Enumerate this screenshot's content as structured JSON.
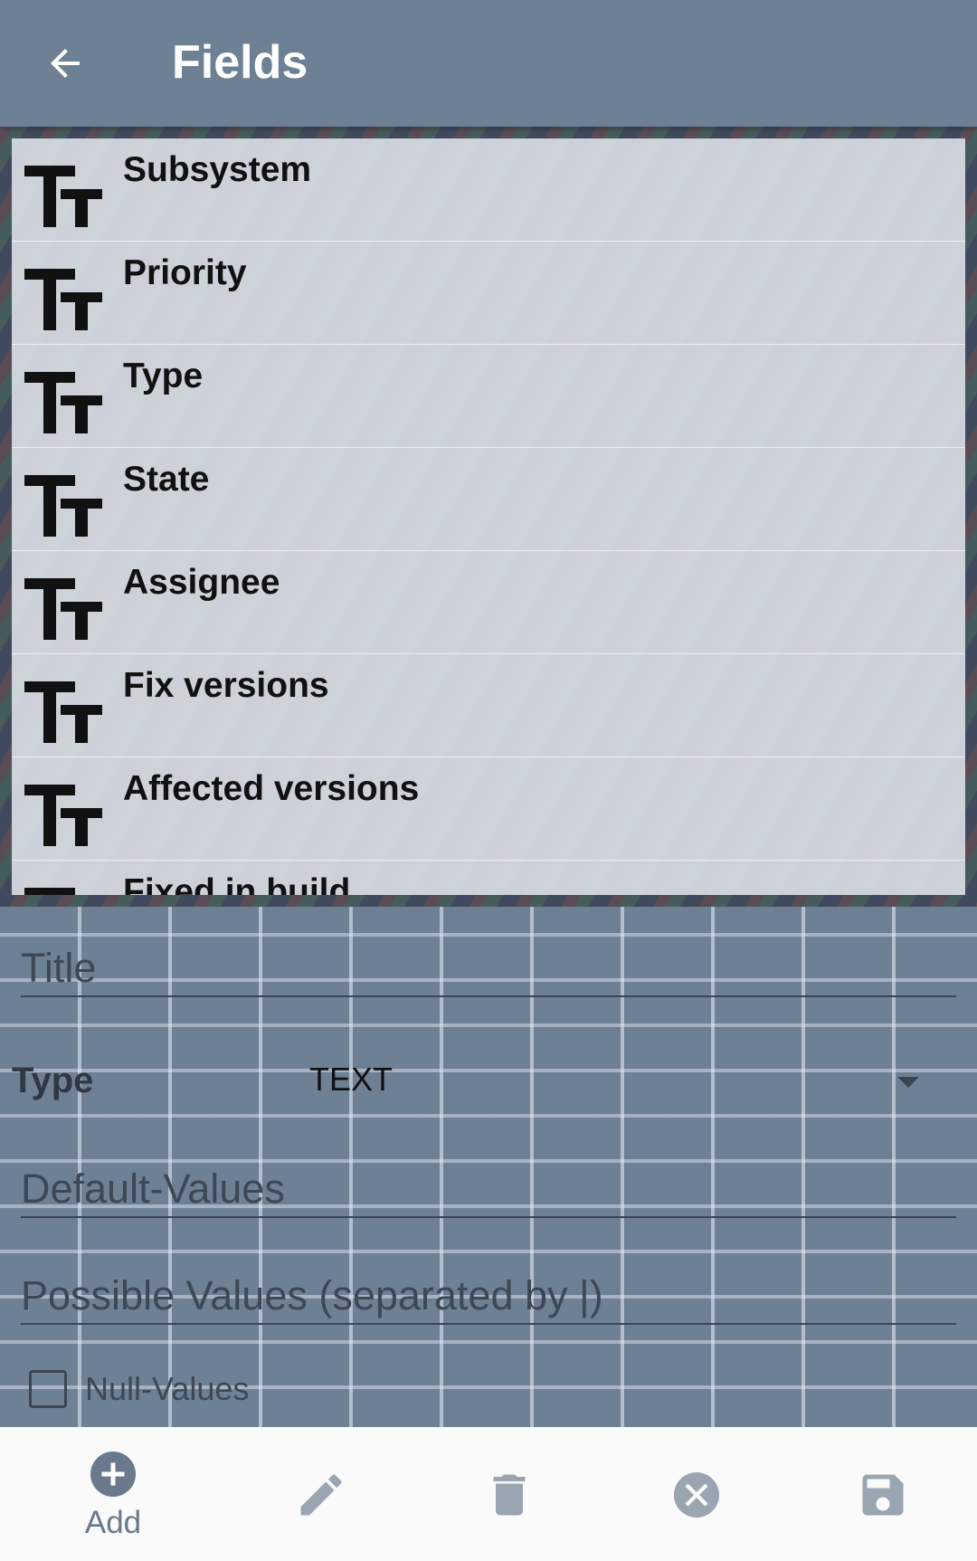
{
  "appbar": {
    "title": "Fields",
    "back_icon": "arrow-back-icon"
  },
  "fields_list": {
    "items": [
      {
        "label": "Subsystem",
        "icon": "text-type-icon"
      },
      {
        "label": "Priority",
        "icon": "text-type-icon"
      },
      {
        "label": "Type",
        "icon": "text-type-icon"
      },
      {
        "label": "State",
        "icon": "text-type-icon"
      },
      {
        "label": "Assignee",
        "icon": "text-type-icon"
      },
      {
        "label": "Fix versions",
        "icon": "text-type-icon"
      },
      {
        "label": "Affected versions",
        "icon": "text-type-icon"
      },
      {
        "label": "Fixed in build",
        "icon": "text-type-icon"
      }
    ]
  },
  "form": {
    "title_placeholder": "Title",
    "type_label": "Type",
    "type_value": "TEXT",
    "default_values_placeholder": "Default-Values",
    "possible_values_placeholder": "Possible Values (separated by |)",
    "null_values_label": "Null-Values",
    "null_values_checked": false
  },
  "bottombar": {
    "add_label": "Add",
    "icons": [
      "add-circle-icon",
      "edit-icon",
      "delete-icon",
      "cancel-icon",
      "save-icon"
    ]
  },
  "colors": {
    "appbar": "#6e8094",
    "icon_gray": "#6a7a8c",
    "list_bg": "#dfe4eb"
  }
}
